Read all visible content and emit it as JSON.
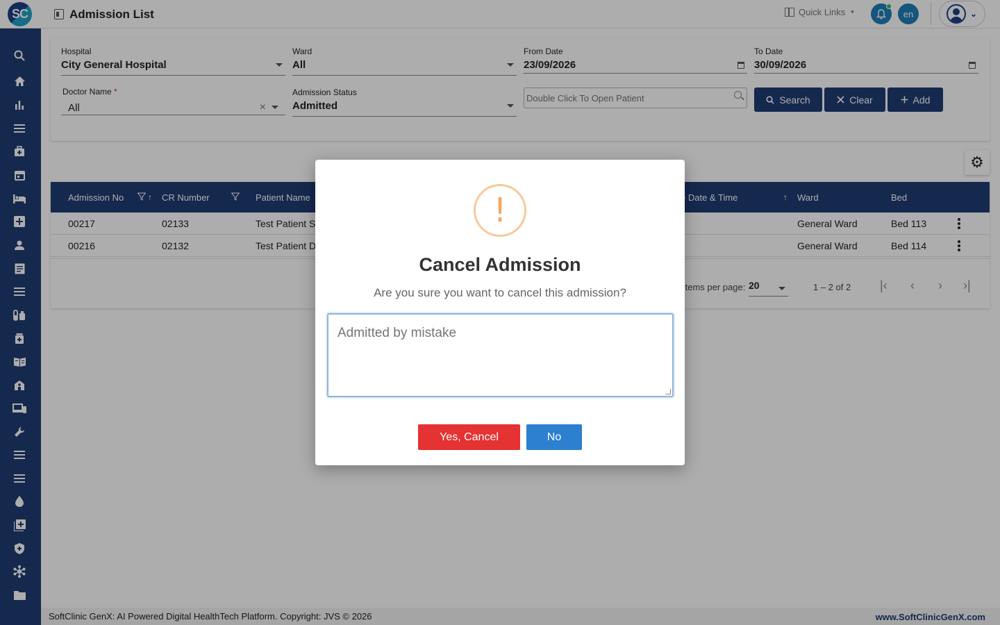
{
  "app": {
    "logo_text": "SC",
    "page_title": "Admission List"
  },
  "header": {
    "quick_links": "Quick Links",
    "language": "en"
  },
  "filters": {
    "hospital": {
      "label": "Hospital",
      "value": "City General Hospital"
    },
    "ward": {
      "label": "Ward",
      "value": "All"
    },
    "from_date": {
      "label": "From Date",
      "value": "23/09/2026"
    },
    "to_date": {
      "label": "To Date",
      "value": "30/09/2026"
    },
    "doctor": {
      "label": "Doctor Name",
      "required_mark": "*",
      "value": "All"
    },
    "status": {
      "label": "Admission Status",
      "value": "Admitted"
    },
    "patient_search": {
      "placeholder": "Double Click To Open Patient"
    },
    "buttons": {
      "search": "Search",
      "clear": "Clear",
      "add": "Add"
    }
  },
  "table": {
    "columns": [
      "Admission No",
      "CR Number",
      "Patient Name",
      "e Date & Time",
      "Ward",
      "Bed"
    ],
    "rows": [
      {
        "admission_no": "00217",
        "cr_number": "02133",
        "patient_name": "Test Patient S",
        "ward": "General Ward",
        "bed": "Bed 113"
      },
      {
        "admission_no": "00216",
        "cr_number": "02132",
        "patient_name": "Test Patient D",
        "ward": "General Ward",
        "bed": "Bed 114"
      }
    ],
    "pager": {
      "items_label": "Items per page:",
      "page_size": "20",
      "range": "1 – 2 of 2"
    }
  },
  "modal": {
    "title": "Cancel Admission",
    "message": "Are you sure you want to cancel this admission?",
    "reason_placeholder": "Admitted by mistake",
    "yes_label": "Yes, Cancel",
    "no_label": "No"
  },
  "footer": {
    "copyright": "SoftClinic GenX: AI Powered Digital HealthTech Platform. Copyright: JVS © 2026",
    "website": "www.SoftClinicGenX.com"
  },
  "colors": {
    "sidebar": "#1f3b73",
    "primary": "#1f3b73",
    "danger": "#e53232",
    "info": "#2d7fcf",
    "warning": "#f2a866"
  }
}
